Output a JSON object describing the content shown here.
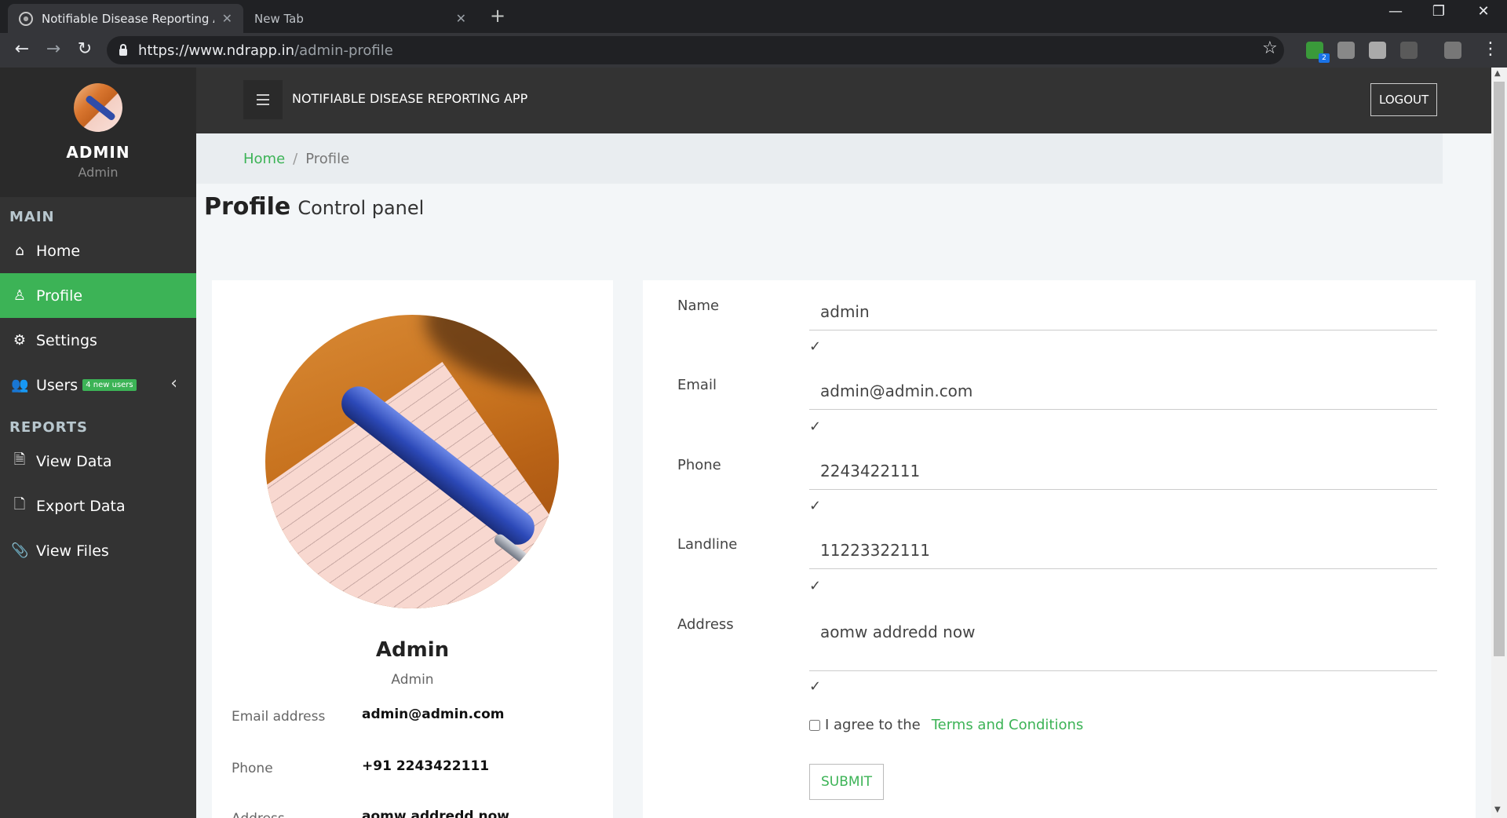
{
  "browser": {
    "tabs": [
      {
        "title": "Notifiable Disease Reporting App",
        "active": true
      },
      {
        "title": "New Tab",
        "active": false
      }
    ],
    "url_host": "https://www.ndrapp.in",
    "url_path": "/admin-profile",
    "extension_badge": "2"
  },
  "sidebar": {
    "user_name": "ADMIN",
    "user_role": "Admin",
    "sections": [
      {
        "header": "MAIN",
        "items": [
          {
            "label": "Home",
            "icon": "home-icon"
          },
          {
            "label": "Profile",
            "icon": "user-icon",
            "active": true
          },
          {
            "label": "Settings",
            "icon": "gear-icon"
          },
          {
            "label": "Users",
            "icon": "users-icon",
            "badge": "4 new users"
          }
        ]
      },
      {
        "header": "REPORTS",
        "items": [
          {
            "label": "View Data",
            "icon": "document-icon"
          },
          {
            "label": "Export Data",
            "icon": "excel-icon"
          },
          {
            "label": "View Files",
            "icon": "paperclip-icon"
          }
        ]
      }
    ]
  },
  "header": {
    "app_title": "NOTIFIABLE DISEASE REPORTING APP",
    "logout_label": "LOGOUT"
  },
  "breadcrumb": {
    "home": "Home",
    "separator": "/",
    "current": "Profile"
  },
  "page": {
    "title": "Profile",
    "subtitle": "Control panel"
  },
  "profile_card": {
    "name": "Admin",
    "role": "Admin",
    "details": [
      {
        "label": "Email address",
        "value": "admin@admin.com"
      },
      {
        "label": "Phone",
        "value": "+91 2243422111"
      },
      {
        "label": "Address",
        "value": "aomw addredd now"
      }
    ]
  },
  "form": {
    "fields": [
      {
        "label": "Name",
        "value": "admin"
      },
      {
        "label": "Email",
        "value": "admin@admin.com"
      },
      {
        "label": "Phone",
        "value": "2243422111"
      },
      {
        "label": "Landline",
        "value": "11223322111"
      },
      {
        "label": "Address",
        "value": "aomw addredd now"
      }
    ],
    "check_mark": "✓",
    "agree_text": "I agree to the",
    "terms_link": "Terms and Conditions",
    "submit_label": "SUBMIT"
  },
  "colors": {
    "accent": "#3cb356",
    "sidebar_bg": "#333333",
    "page_bg": "#f3f6f8"
  }
}
